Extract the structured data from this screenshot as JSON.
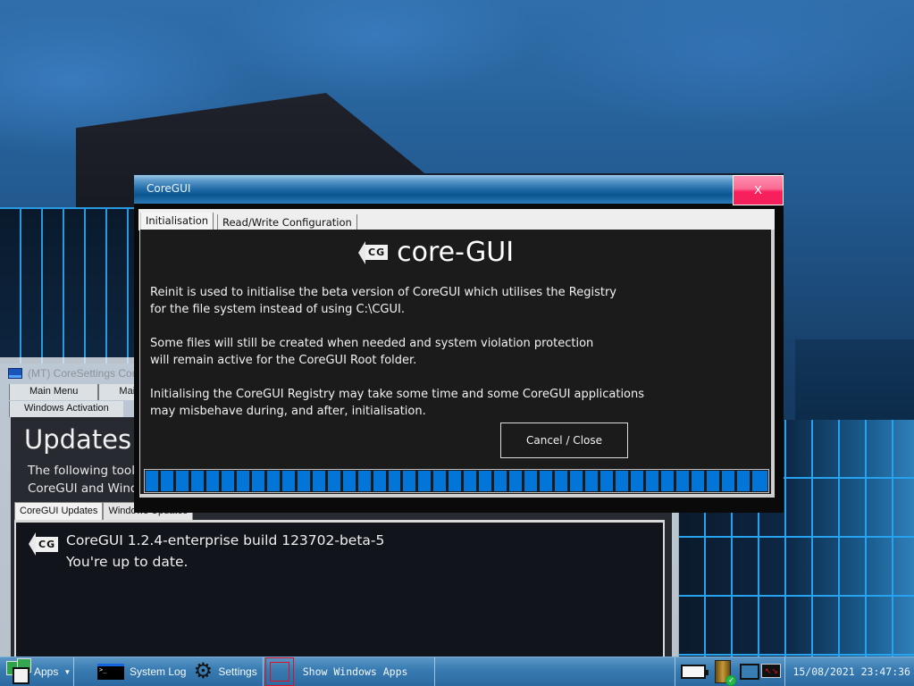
{
  "desktop": {
    "wallpaper": "city-buildings-blue-sky"
  },
  "background_window": {
    "title": "(MT) CoreSettings Core",
    "icon": "app-window-icon",
    "tabs_row1": [
      "Main Menu",
      "Mai"
    ],
    "tabs_row2": [
      "Windows Activation"
    ],
    "heading": "Updates",
    "description_lines": [
      "The following tool",
      "CoreGUI and Wind"
    ],
    "subtabs": [
      "CoreGUI Updates",
      "Windows Updates"
    ],
    "logo_text": "CG",
    "version_line": "CoreGUI 1.2.4-enterprise build 123702-beta-5",
    "status_line": "You're up to date."
  },
  "dialog": {
    "title": "CoreGUI",
    "close_label": "X",
    "tabs": [
      {
        "label": "Initialisation",
        "active": true
      },
      {
        "label": "Read/Write Configuration",
        "active": false
      }
    ],
    "logo_badge": "CG",
    "logo_text": "core-GUI",
    "paragraphs": [
      [
        "Reinit is used to initialise the beta version of CoreGUI which utilises the Registry",
        "for the file system instead of using C:\\CGUI."
      ],
      [
        "Some files will still be created when needed and system violation protection",
        "will remain active for the CoreGUI Root folder."
      ],
      [
        "Initialising the CoreGUI Registry may take some time and some CoreGUI applications",
        "may misbehave during, and after, initialisation."
      ]
    ],
    "cancel_label": "Cancel / Close",
    "progress": {
      "percent": 100,
      "segments": 41,
      "color": "#0275d8"
    }
  },
  "taskbar": {
    "apps_label": "Apps",
    "apps_dropdown_icon": "caret-down-icon",
    "items": [
      {
        "label": "System Log",
        "icon": "terminal-icon"
      },
      {
        "label": "Settings",
        "icon": "gear-icon"
      },
      {
        "label": "Show Windows Apps",
        "icon": "windows-apps-icon"
      }
    ],
    "tray_icons": [
      "battery-icon",
      "drive-status-icon",
      "network-icon",
      "remote-desktop-icon"
    ],
    "clock": "15/08/2021 23:47:36"
  },
  "colors": {
    "title_bar": "#1f6aa7",
    "close_button": "#fa1f5e",
    "dialog_bg": "#1b1b1b",
    "progress_fill": "#0275d8",
    "taskbar": "#3a7db3"
  }
}
